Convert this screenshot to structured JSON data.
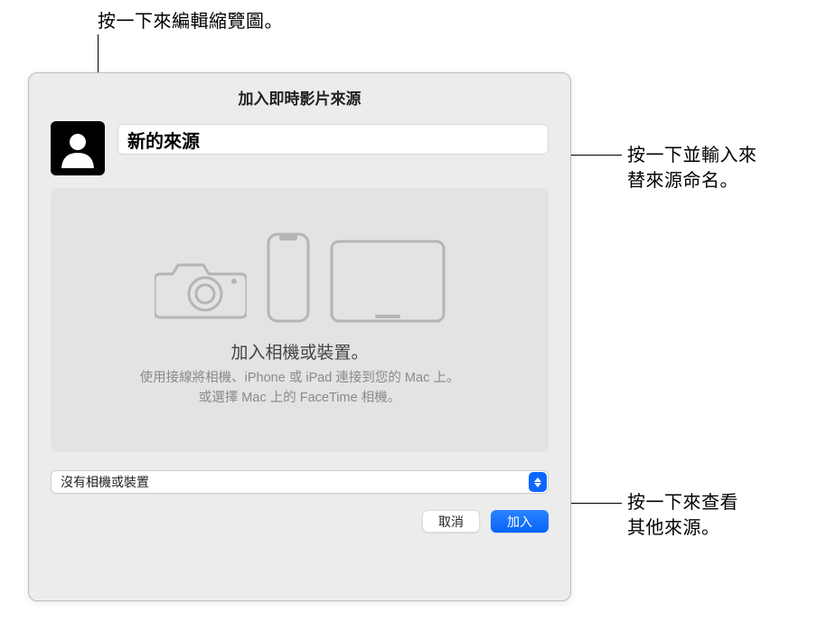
{
  "callouts": {
    "top": "按一下來編輯縮覽圖。",
    "right1_line1": "按一下並輸入來",
    "right1_line2": "替來源命名。",
    "right2_line1": "按一下來查看",
    "right2_line2": "其他來源。"
  },
  "dialog": {
    "title": "加入即時影片來源",
    "source_name": "新的來源",
    "device_zone": {
      "title": "加入相機或裝置。",
      "desc_line1": "使用接線將相機、iPhone 或 iPad 連接到您的 Mac 上。",
      "desc_line2": "或選擇 Mac 上的 FaceTime 相機。"
    },
    "select_label": "沒有相機或裝置",
    "buttons": {
      "cancel": "取消",
      "add": "加入"
    }
  },
  "icons": {
    "thumbnail": "person-silhouette-icon",
    "camera": "camera-icon",
    "phone": "iphone-icon",
    "tablet": "ipad-icon",
    "dropdown": "updown-chevrons-icon"
  }
}
